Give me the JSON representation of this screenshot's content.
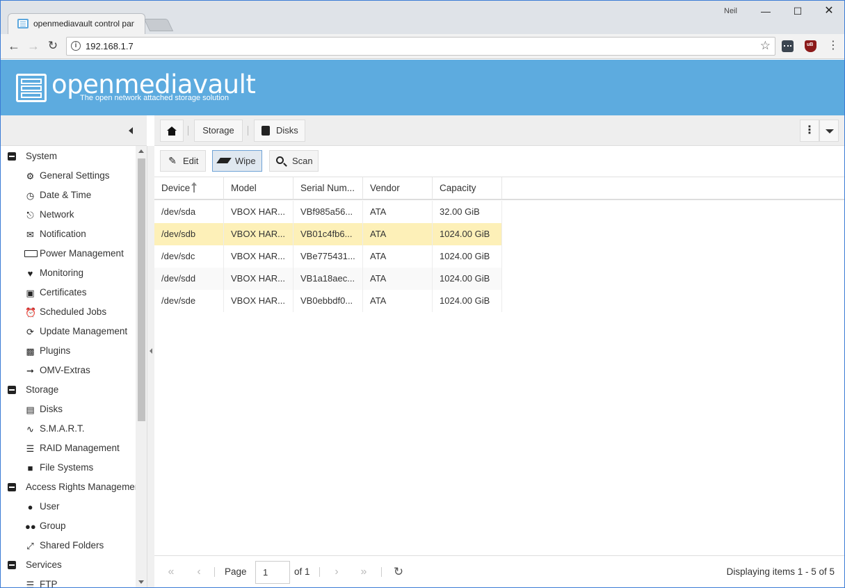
{
  "browser": {
    "tab_title": "openmediavault control panel",
    "user_label": "Neil",
    "url": "192.168.1.7"
  },
  "header": {
    "logo_text": "openmediavault",
    "tagline": "The open network attached storage solution"
  },
  "breadcrumb": {
    "storage": "Storage",
    "disks": "Disks"
  },
  "sidebar": {
    "system": "System",
    "general_settings": "General Settings",
    "date_time": "Date & Time",
    "network": "Network",
    "notification": "Notification",
    "power_management": "Power Management",
    "monitoring": "Monitoring",
    "certificates": "Certificates",
    "scheduled_jobs": "Scheduled Jobs",
    "update_management": "Update Management",
    "plugins": "Plugins",
    "omv_extras": "OMV-Extras",
    "storage": "Storage",
    "disks": "Disks",
    "smart": "S.M.A.R.T.",
    "raid_management": "RAID Management",
    "file_systems": "File Systems",
    "access_rights": "Access Rights Management",
    "user": "User",
    "group": "Group",
    "shared_folders": "Shared Folders",
    "services": "Services",
    "ftp": "FTP"
  },
  "toolbar": {
    "edit": "Edit",
    "wipe": "Wipe",
    "scan": "Scan"
  },
  "grid": {
    "columns": {
      "device": "Device",
      "model": "Model",
      "serial": "Serial Num...",
      "vendor": "Vendor",
      "capacity": "Capacity"
    },
    "rows": [
      {
        "device": "/dev/sda",
        "model": "VBOX HAR...",
        "serial": "VBf985a56...",
        "vendor": "ATA",
        "capacity": "32.00 GiB"
      },
      {
        "device": "/dev/sdb",
        "model": "VBOX HAR...",
        "serial": "VB01c4fb6...",
        "vendor": "ATA",
        "capacity": "1024.00 GiB"
      },
      {
        "device": "/dev/sdc",
        "model": "VBOX HAR...",
        "serial": "VBe775431...",
        "vendor": "ATA",
        "capacity": "1024.00 GiB"
      },
      {
        "device": "/dev/sdd",
        "model": "VBOX HAR...",
        "serial": "VB1a18aec...",
        "vendor": "ATA",
        "capacity": "1024.00 GiB"
      },
      {
        "device": "/dev/sde",
        "model": "VBOX HAR...",
        "serial": "VB0ebbdf0...",
        "vendor": "ATA",
        "capacity": "1024.00 GiB"
      }
    ]
  },
  "paging": {
    "page_label": "Page",
    "page_value": "1",
    "of_label": "of 1",
    "display_info": "Displaying items 1 - 5 of 5"
  },
  "colors": {
    "banner": "#5dabdf",
    "selected_row": "#fdf0b8"
  }
}
